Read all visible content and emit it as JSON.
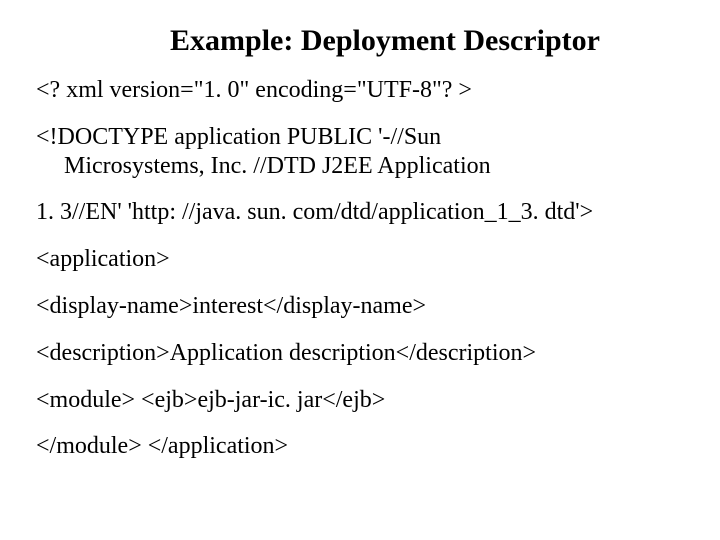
{
  "title": "Example: Deployment Descriptor",
  "lines": {
    "l1": "<? xml version=\"1. 0\" encoding=\"UTF-8\"? >",
    "l2a": "<!DOCTYPE application PUBLIC '-//Sun",
    "l2b": "Microsystems, Inc. //DTD J2EE Application",
    "l3": "1. 3//EN' 'http: //java. sun. com/dtd/application_1_3. dtd'>",
    "l4": "<application>",
    "l5": "<display-name>interest</display-name>",
    "l6": "<description>Application description</description>",
    "l7": "<module>   <ejb>ejb-jar-ic. jar</ejb>",
    "l8": "</module>   </application>"
  }
}
